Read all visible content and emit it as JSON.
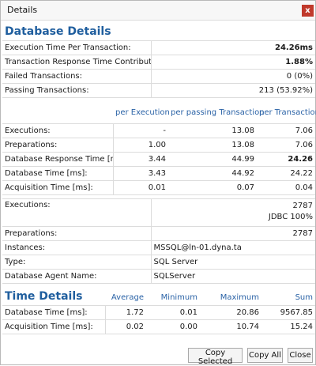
{
  "window": {
    "title": "Details",
    "close_glyph": "x"
  },
  "database_details": {
    "title": "Database Details",
    "summary": [
      {
        "label": "Execution Time Per Transaction:",
        "value": "24.26ms",
        "bold": true
      },
      {
        "label": "Transaction Response Time Contribution:",
        "value": "1.88%",
        "bold": true
      },
      {
        "label": "Failed Transactions:",
        "value": "0 (0%)",
        "bold": false
      },
      {
        "label": "Passing Transactions:",
        "value": "213 (53.92%)",
        "bold": false
      }
    ],
    "metrics_headers": [
      "per Execution",
      "per passing Transaction",
      "per Transaction"
    ],
    "metrics": [
      {
        "label": "Executions:",
        "values": [
          "-",
          "13.08",
          "7.06"
        ],
        "bold": false
      },
      {
        "label": "Preparations:",
        "values": [
          "1.00",
          "13.08",
          "7.06"
        ],
        "bold": false
      },
      {
        "label": "Database Response Time [ms]:",
        "values": [
          "3.44",
          "44.99",
          "24.26"
        ],
        "bold_last": true
      },
      {
        "label": "Database Time [ms]:",
        "values": [
          "3.43",
          "44.92",
          "24.22"
        ],
        "bold": false
      },
      {
        "label": "Acquisition Time [ms]:",
        "values": [
          "0.01",
          "0.07",
          "0.04"
        ],
        "bold": false
      }
    ],
    "info": [
      {
        "label": "Executions:",
        "value": "2787",
        "value2": "JDBC 100%"
      },
      {
        "label": "Preparations:",
        "value": "2787"
      },
      {
        "label": "Instances:",
        "value": "MSSQL@ln-01.dyna.ta"
      },
      {
        "label": "Type:",
        "value": "SQL Server"
      },
      {
        "label": "Database Agent Name:",
        "value": "SQLServer"
      }
    ]
  },
  "time_details": {
    "title": "Time Details",
    "headers": [
      "Average",
      "Minimum",
      "Maximum",
      "Sum"
    ],
    "rows": [
      {
        "label": "Database Time [ms]:",
        "values": [
          "1.72",
          "0.01",
          "20.86",
          "9567.85"
        ]
      },
      {
        "label": "Acquisition Time [ms]:",
        "values": [
          "0.02",
          "0.00",
          "10.74",
          "15.24"
        ]
      }
    ]
  },
  "buttons": {
    "copy_selected": "Copy Selected",
    "copy_all": "Copy All",
    "close": "Close"
  },
  "colors": {
    "section_title": "#1f5e9e",
    "column_header": "#2a62a6",
    "close_button": "#c0392b"
  }
}
